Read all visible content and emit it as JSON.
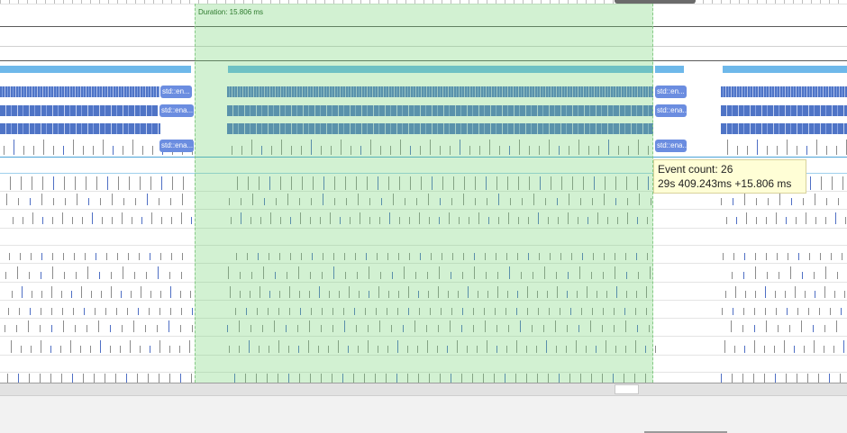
{
  "selection": {
    "duration_label": "Duration: 15.806 ms"
  },
  "slices": {
    "label_1": "std::en...",
    "label_2": "std::ena...",
    "label_3": "std::ena...",
    "label_4": "std::en...",
    "label_5": "std::ena...",
    "label_6": "std::ena..."
  },
  "tooltip": {
    "event_count": "Event count: 26",
    "timestamp": "29s 409.243ms +15.806 ms"
  },
  "colors": {
    "selection": "#74d274",
    "slice": "#4f74c6",
    "cpu": "#6eb8ea",
    "tooltip_bg": "#fffed6"
  }
}
